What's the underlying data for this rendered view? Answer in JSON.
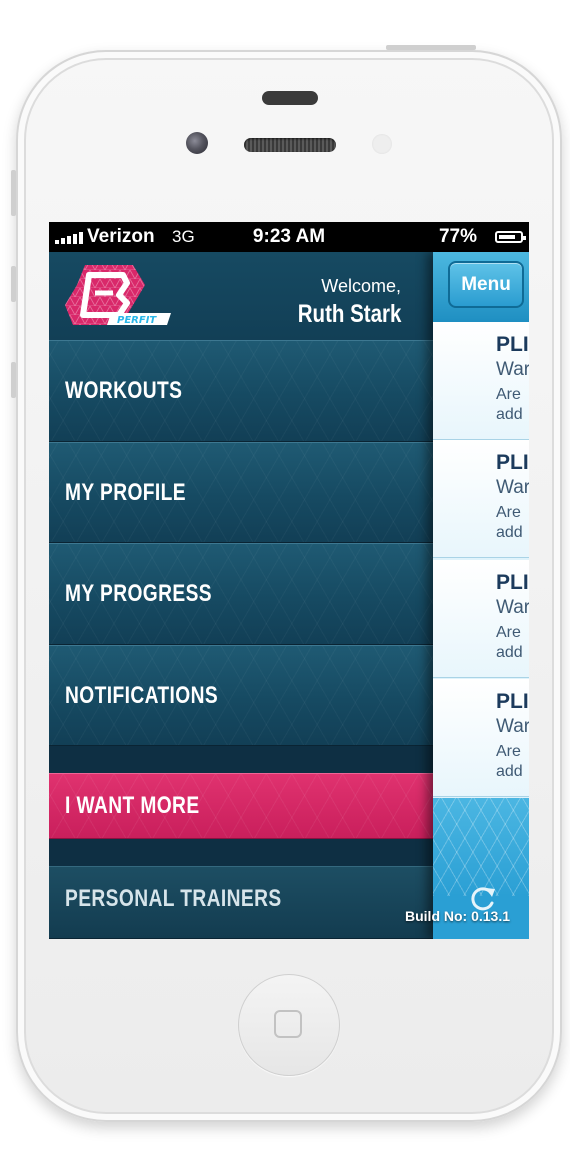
{
  "status_bar": {
    "carrier": "Verizon",
    "network": "3G",
    "time": "9:23 AM",
    "battery": "77%"
  },
  "app": {
    "brand": "PERFIT",
    "welcome": "Welcome,",
    "user_name": "Ruth Stark"
  },
  "menu": {
    "items": [
      {
        "label": "WORKOUTS"
      },
      {
        "label": "MY PROFILE"
      },
      {
        "label": "MY PROGRESS"
      },
      {
        "label": "NOTIFICATIONS"
      },
      {
        "label": "I WANT MORE"
      },
      {
        "label": "PERSONAL TRAINERS"
      }
    ]
  },
  "panel": {
    "menu_button": "Menu",
    "cards": [
      {
        "title": "PLI",
        "subtitle": "War",
        "desc_1": "Are",
        "desc_2": "add"
      },
      {
        "title": "PLI",
        "subtitle": "War",
        "desc_1": "Are",
        "desc_2": "add"
      },
      {
        "title": "PLI",
        "subtitle": "War",
        "desc_1": "Are",
        "desc_2": "add"
      },
      {
        "title": "PLI",
        "subtitle": "War",
        "desc_1": "Are",
        "desc_2": "add"
      }
    ],
    "build": "Build No: 0.13.1"
  },
  "colors": {
    "menu_bg": "#164a62",
    "accent_pink": "#d9286a",
    "panel_blue": "#2a9fd4",
    "brand_cyan": "#29b6e8"
  },
  "icons": {
    "logo": "perfit-logo",
    "refresh": "refresh-icon",
    "home": "home-button-icon"
  }
}
